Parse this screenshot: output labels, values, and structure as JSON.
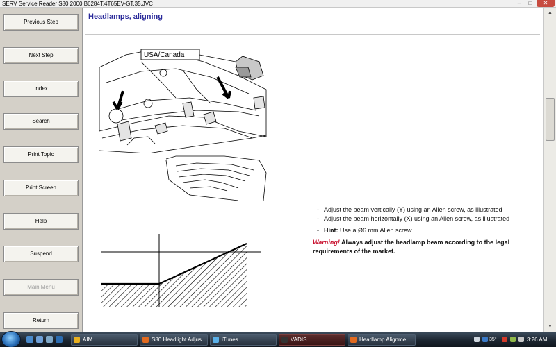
{
  "window": {
    "title": "SERV Service Reader S80,2000,B6284T,4T65EV-GT,35,JVC",
    "min_label": "–",
    "max_label": "□",
    "close_label": "✕"
  },
  "sidebar": {
    "buttons": [
      {
        "label": "Previous Step"
      },
      {
        "label": "Next Step"
      },
      {
        "label": "Index"
      },
      {
        "label": "Search"
      },
      {
        "label": "Print Topic"
      },
      {
        "label": "Print Screen"
      },
      {
        "label": "Help"
      },
      {
        "label": "Suspend"
      },
      {
        "label": "Main Menu"
      },
      {
        "label": "Return"
      }
    ]
  },
  "page": {
    "title": "Headlamps, aligning",
    "illustration_label": "USA/Canada",
    "instructions": [
      "Adjust the beam vertically (Y) using an Allen screw, as illustrated",
      "Adjust the beam horizontally (X) using an Allen screw, as illustrated"
    ],
    "hint_label": "Hint:",
    "hint_text": "Use a Ø6 mm Allen screw.",
    "warning_label": "Warning!",
    "warning_text": "Always adjust the headlamp beam according to the legal requirements of the market."
  },
  "taskbar": {
    "tasks": [
      {
        "label": "AIM"
      },
      {
        "label": "S80 Headlight Adjus..."
      },
      {
        "label": "iTunes"
      },
      {
        "label": "VADIS"
      },
      {
        "label": "Headlamp Alignme..."
      }
    ],
    "tray_value": "35°",
    "clock": "3:26 AM"
  },
  "colors": {
    "title_blue": "#2a2a9a",
    "warning_red": "#c8102e",
    "task_active": "#5c2e2e"
  }
}
